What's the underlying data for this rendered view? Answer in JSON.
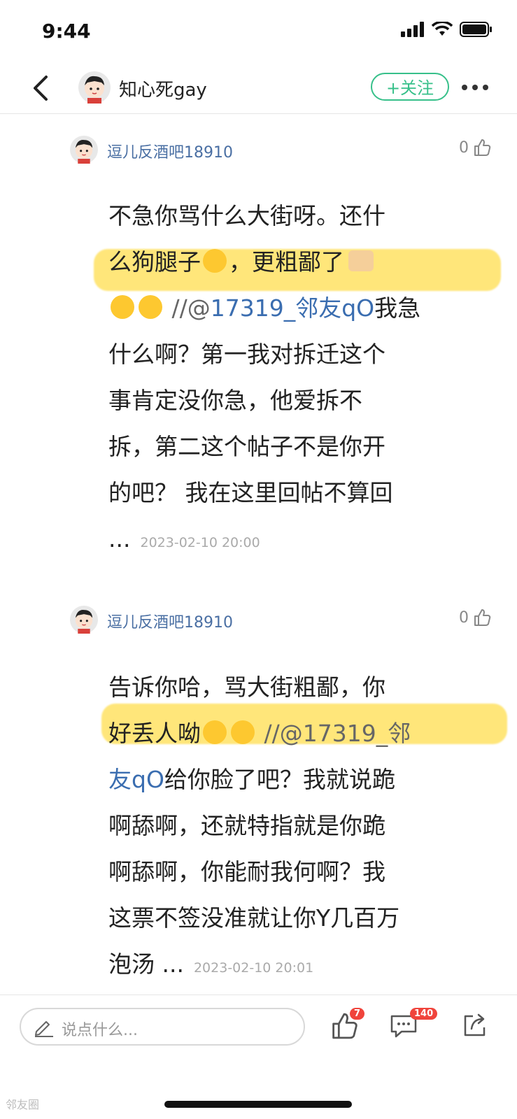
{
  "status": {
    "time": "9:44"
  },
  "nav": {
    "title": "知心死gay",
    "follow_label": "+关注"
  },
  "comments": [
    {
      "user": "逗儿反酒吧18910",
      "likes": "0",
      "line1": "不急你骂什么大街呀。还什",
      "line2a": "么狗腿子",
      "line2b": "，更粗鄙了",
      "line3_prefix": "//@",
      "mention": "17319_邻友qO",
      "line3_suffix": "我急",
      "line4": "什么啊？第一我对拆迁这个",
      "line5": "事肯定没你急，他爱拆不",
      "line6": "拆，第二这个帖子不是你开",
      "line7": "的吧？ 我在这里回帖不算回",
      "ellipsis": "...",
      "date": "2023-02-10 20:00"
    },
    {
      "user": "逗儿反酒吧18910",
      "likes": "0",
      "line1": "告诉你哈，骂大街粗鄙，你",
      "line2a": "好丢人呦",
      "line2_ref": "//@17319_邻",
      "mention_tail": "友qO",
      "line3_suffix": "给你脸了吧？我就说跪",
      "line4": "啊舔啊，还就特指就是你跪",
      "line5": "啊舔啊，你能耐我何啊？我",
      "line6": "这票不签没准就让你Y几百万",
      "line7": "泡汤 ...",
      "date": "2023-02-10 20:01"
    }
  ],
  "bottom": {
    "placeholder": "说点什么...",
    "like_count": "7",
    "comment_count": "140"
  },
  "watermark": "邻友圈",
  "colors": {
    "accent": "#37c08a",
    "link": "#3a6db0",
    "badge": "#f0443c",
    "highlight": "#ffdd46"
  }
}
